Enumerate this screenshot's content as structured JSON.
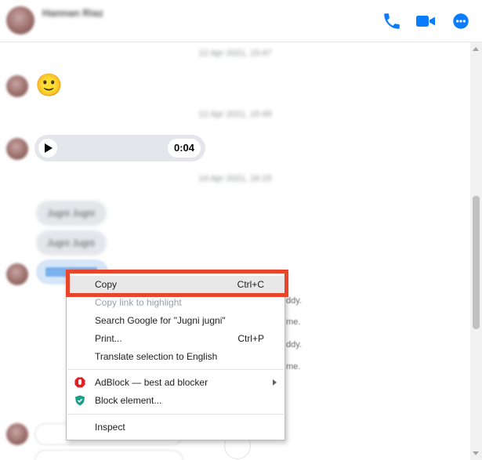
{
  "header": {
    "contact_name": "Hannan Riaz",
    "contact_status": "",
    "icons": [
      "phone-icon",
      "video-camera-icon",
      "more-options-icon"
    ],
    "accent_color": "#0a7cff"
  },
  "messages": {
    "date_separators": [
      "12 Apr 2021, 15:47",
      "12 Apr 2021, 15:49",
      "14 Apr 2021, 16:15"
    ],
    "emoji_message": "🙂",
    "audio_duration": "0:04",
    "text_bubbles": [
      "Jugni Jugni",
      "Jugni Jugni"
    ],
    "side_texts": [
      "ddy.",
      "me.",
      "ddy.",
      "me."
    ]
  },
  "context_menu": {
    "copy": {
      "label": "Copy",
      "shortcut": "Ctrl+C"
    },
    "copy_link": {
      "label": "Copy link to highlight"
    },
    "search": {
      "label": "Search Google for \"Jugni jugni\""
    },
    "print": {
      "label": "Print...",
      "shortcut": "Ctrl+P"
    },
    "translate": {
      "label": "Translate selection to English"
    },
    "adblock": {
      "label": "AdBlock — best ad blocker"
    },
    "block_element": {
      "label": "Block element..."
    },
    "inspect": {
      "label": "Inspect"
    }
  },
  "annotation": {
    "color": "#e8452a"
  }
}
